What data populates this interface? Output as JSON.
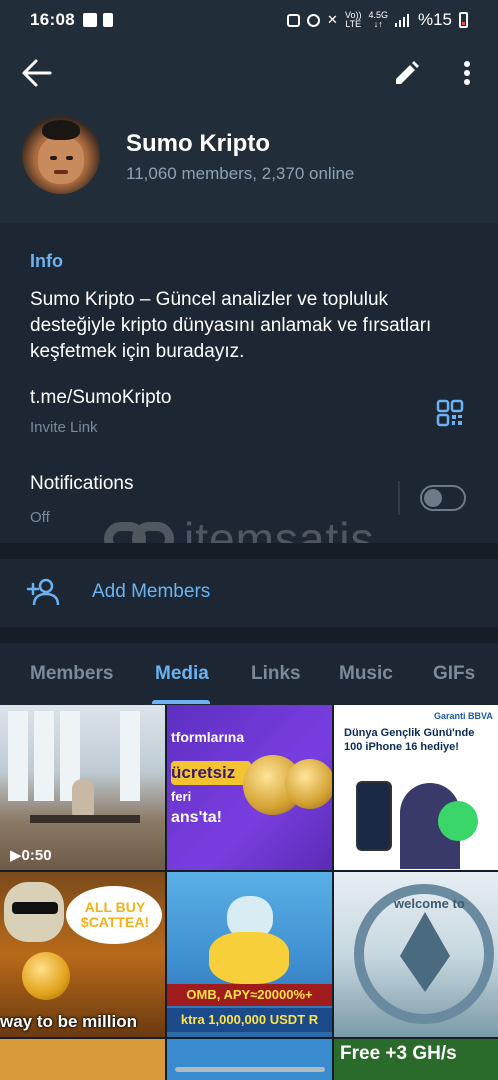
{
  "status_bar": {
    "time": "16:08",
    "network_top": "Vo))",
    "network_bottom": "LTE",
    "speed_top": "4.5G",
    "speed_bottom": "↓↑",
    "battery": "%15"
  },
  "header": {
    "title": "Sumo Kripto",
    "subtitle": "11,060 members, 2,370 online"
  },
  "info": {
    "heading": "Info",
    "description": "Sumo Kripto – Güncel analizler ve topluluk desteğiyle kripto dünyasını anlamak ve fırsatları keşfetmek için buradayız.",
    "link": "t.me/SumoKripto",
    "link_label": "Invite Link",
    "notifications_label": "Notifications",
    "notifications_state": "Off"
  },
  "watermark": {
    "text": "itemsatis"
  },
  "actions": {
    "add_members": "Add Members"
  },
  "tabs": [
    "Members",
    "Media",
    "Links",
    "Music",
    "GIFs"
  ],
  "active_tab": "Media",
  "media": {
    "video_duration": "0:50",
    "tile2_lines": [
      "tformlarına",
      "ücretsiz",
      "feri",
      "ans'ta!"
    ],
    "tile3_brand": "Garanti BBVA",
    "tile3_headline": "Dünya Gençlik Günü'nde",
    "tile3_headline2": "100 iPhone 16 hediye!",
    "tile4_bubble": "ALL BUY $CATTEA!",
    "tile4_caption": "way to be million",
    "tile5_line1": "OMB, APY≈20000%+",
    "tile5_line2": "ktra 1,000,000 USDT R",
    "tile6_text": "welcome to",
    "tile9_text": "Free +3 GH/s"
  },
  "colors": {
    "background": "#1d2733",
    "header_bg": "#222d3a",
    "accent": "#6ab2f2",
    "muted_text": "#7a8a9a"
  }
}
